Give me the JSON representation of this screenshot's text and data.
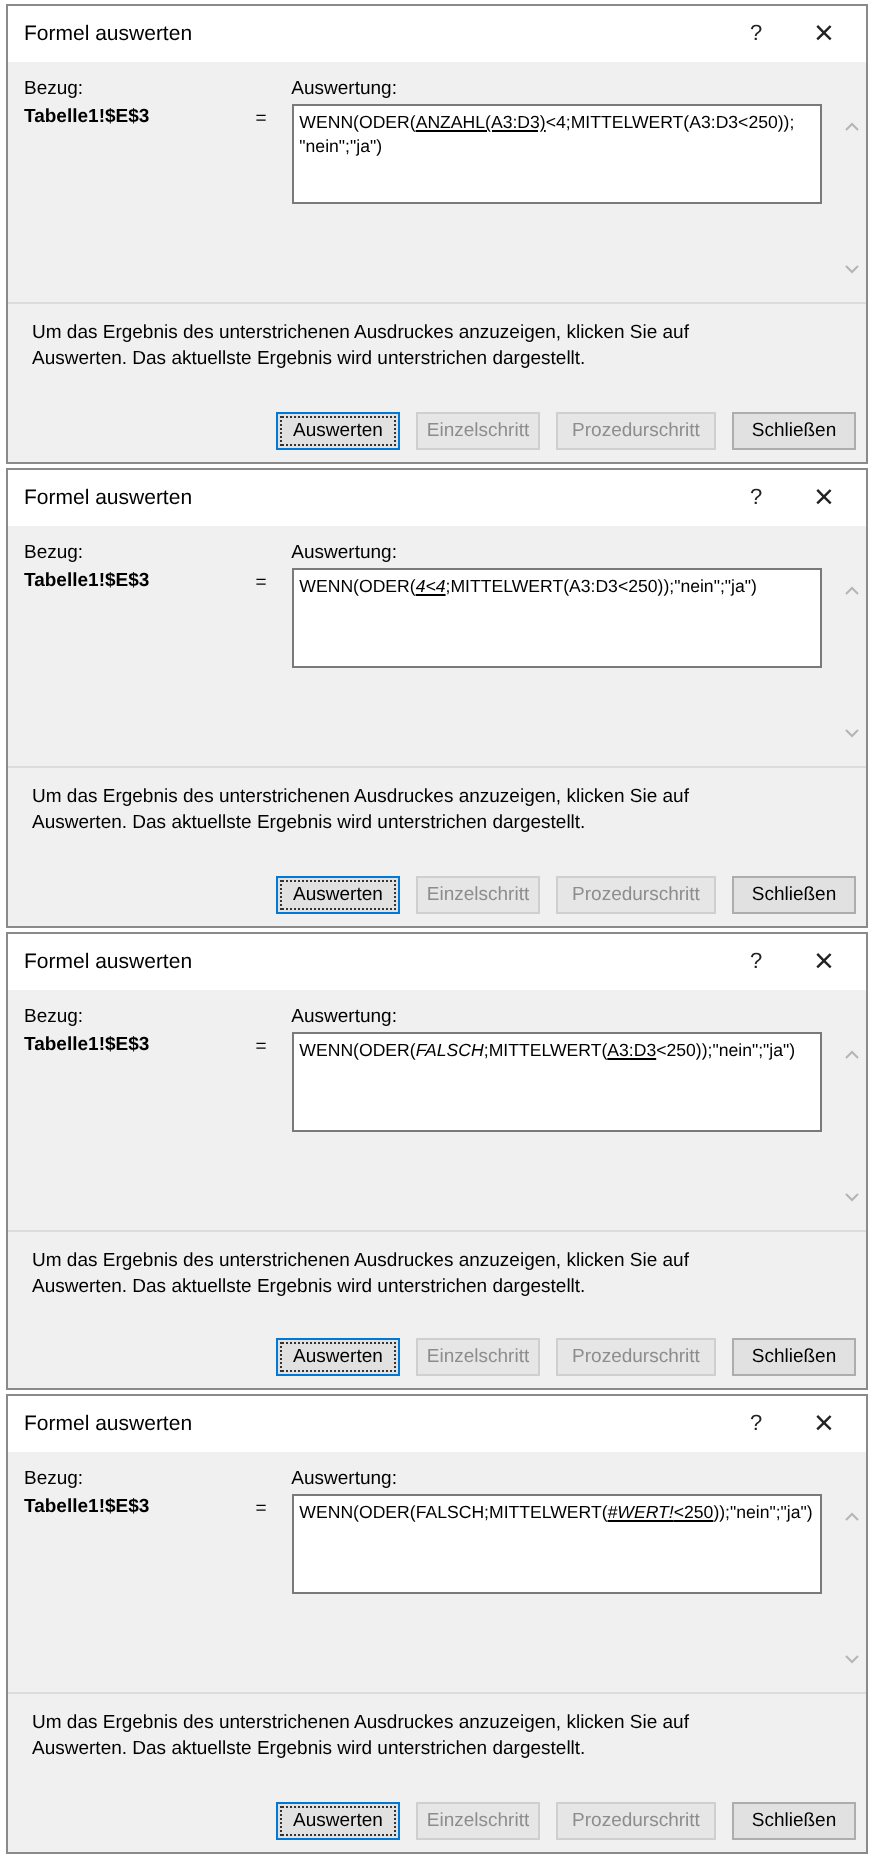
{
  "dialogs": [
    {
      "title": "Formel auswerten",
      "help": "?",
      "close": "×",
      "reference_label": "Bezug:",
      "reference": "Tabelle1!$E$3",
      "equals": "=",
      "evaluation_label": "Auswertung:",
      "formula": [
        {
          "text": "WENN(ODER(",
          "underlined": false,
          "italic": false
        },
        {
          "text": "ANZAHL(A3:D3)",
          "underlined": true,
          "italic": false
        },
        {
          "text": "<4;MITTELWERT(A3:D3<250)); \"nein\";\"ja\")",
          "underlined": false,
          "italic": false
        }
      ],
      "message": "Um das Ergebnis des unterstrichenen Ausdruckes anzuzeigen, klicken Sie auf Auswerten. Das aktuellste Ergebnis wird unterstrichen dargestellt.",
      "buttons": [
        {
          "label": "Auswerten",
          "disabled": false,
          "selected": true
        },
        {
          "label": "Einzelschritt",
          "disabled": true,
          "selected": false
        },
        {
          "label": "Prozedurschritt",
          "disabled": true,
          "selected": false
        },
        {
          "label": "Schließen",
          "disabled": false,
          "selected": false
        }
      ]
    },
    {
      "title": "Formel auswerten",
      "help": "?",
      "close": "×",
      "reference_label": "Bezug:",
      "reference": "Tabelle1!$E$3",
      "equals": "=",
      "evaluation_label": "Auswertung:",
      "formula": [
        {
          "text": "WENN(ODER(",
          "underlined": false,
          "italic": false
        },
        {
          "text": "4<4",
          "underlined": true,
          "italic": true
        },
        {
          "text": ";MITTELWERT(A3:D3<250));\"nein\";\"ja\")",
          "underlined": false,
          "italic": false
        }
      ],
      "message": "Um das Ergebnis des unterstrichenen Ausdruckes anzuzeigen, klicken Sie auf Auswerten. Das aktuellste Ergebnis wird unterstrichen dargestellt.",
      "buttons": [
        {
          "label": "Auswerten",
          "disabled": false,
          "selected": true
        },
        {
          "label": "Einzelschritt",
          "disabled": true,
          "selected": false
        },
        {
          "label": "Prozedurschritt",
          "disabled": true,
          "selected": false
        },
        {
          "label": "Schließen",
          "disabled": false,
          "selected": false
        }
      ]
    },
    {
      "title": "Formel auswerten",
      "help": "?",
      "close": "×",
      "reference_label": "Bezug:",
      "reference": "Tabelle1!$E$3",
      "equals": "=",
      "evaluation_label": "Auswertung:",
      "formula": [
        {
          "text": "WENN(ODER(",
          "underlined": false,
          "italic": false
        },
        {
          "text": "FALSCH",
          "underlined": false,
          "italic": true
        },
        {
          "text": ";MITTELWERT(",
          "underlined": false,
          "italic": false
        },
        {
          "text": "A3:D3",
          "underlined": true,
          "italic": false
        },
        {
          "text": "<250));\"nein\";\"ja\")",
          "underlined": false,
          "italic": false
        }
      ],
      "message": "Um das Ergebnis des unterstrichenen Ausdruckes anzuzeigen, klicken Sie auf Auswerten. Das aktuellste Ergebnis wird unterstrichen dargestellt.",
      "buttons": [
        {
          "label": "Auswerten",
          "disabled": false,
          "selected": true
        },
        {
          "label": "Einzelschritt",
          "disabled": true,
          "selected": false
        },
        {
          "label": "Prozedurschritt",
          "disabled": true,
          "selected": false
        },
        {
          "label": "Schließen",
          "disabled": false,
          "selected": false
        }
      ]
    },
    {
      "title": "Formel auswerten",
      "help": "?",
      "close": "×",
      "reference_label": "Bezug:",
      "reference": "Tabelle1!$E$3",
      "equals": "=",
      "evaluation_label": "Auswertung:",
      "formula": [
        {
          "text": "WENN(ODER(FALSCH;MITTELWERT(",
          "underlined": false,
          "italic": false
        },
        {
          "text": "#WERT!",
          "underlined": true,
          "italic": true
        },
        {
          "text": "<250",
          "underlined": true,
          "italic": false
        },
        {
          "text": "));\"nein\";\"ja\")",
          "underlined": false,
          "italic": false
        }
      ],
      "message": "Um das Ergebnis des unterstrichenen Ausdruckes anzuzeigen, klicken Sie auf Auswerten. Das aktuellste Ergebnis wird unterstrichen dargestellt.",
      "buttons": [
        {
          "label": "Auswerten",
          "disabled": false,
          "selected": true
        },
        {
          "label": "Einzelschritt",
          "disabled": true,
          "selected": false
        },
        {
          "label": "Prozedurschritt",
          "disabled": true,
          "selected": false
        },
        {
          "label": "Schließen",
          "disabled": false,
          "selected": false
        }
      ]
    }
  ]
}
